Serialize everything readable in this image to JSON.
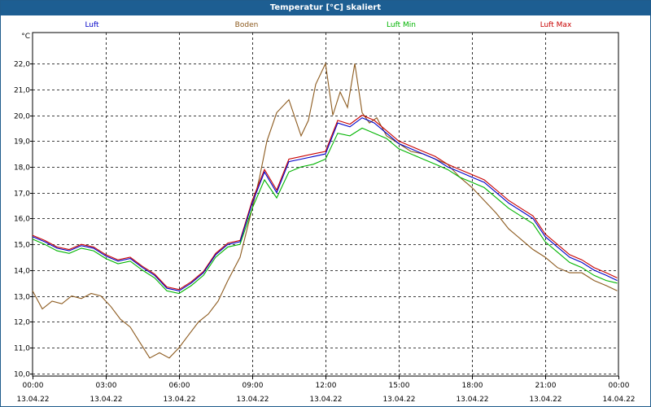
{
  "window": {
    "title": "Temperatur [°C] skaliert"
  },
  "chart_data": {
    "type": "line",
    "title": "Temperatur [°C] skaliert",
    "ylabel": "°C",
    "xlabel": "",
    "ylim": [
      9.9,
      23.2
    ],
    "xlim": [
      0,
      24
    ],
    "grid": true,
    "yticks": [
      10.0,
      11.0,
      12.0,
      13.0,
      14.0,
      15.0,
      16.0,
      17.0,
      18.0,
      19.0,
      20.0,
      21.0,
      22.0
    ],
    "ytick_labels": [
      "10,0",
      "11,0",
      "12,0",
      "13,0",
      "14,0",
      "15,0",
      "16,0",
      "17,0",
      "18,0",
      "19,0",
      "20,0",
      "21,0",
      "22,0"
    ],
    "xticks": [
      0,
      3,
      6,
      9,
      12,
      15,
      18,
      21,
      24
    ],
    "xtick_labels": [
      [
        "00:00",
        "13.04.22"
      ],
      [
        "03:00",
        "13.04.22"
      ],
      [
        "06:00",
        "13.04.22"
      ],
      [
        "09:00",
        "13.04.22"
      ],
      [
        "12:00",
        "13.04.22"
      ],
      [
        "15:00",
        "13.04.22"
      ],
      [
        "18:00",
        "13.04.22"
      ],
      [
        "21:00",
        "13.04.22"
      ],
      [
        "00:00",
        "14.04.22"
      ]
    ],
    "legend_position": "top",
    "series": [
      {
        "name": "Luft",
        "color": "#0000c8",
        "x": [
          0,
          0.5,
          1,
          1.5,
          2,
          2.5,
          3,
          3.5,
          4,
          4.5,
          5,
          5.5,
          6,
          6.5,
          7,
          7.5,
          8,
          8.5,
          9,
          9.5,
          10,
          10.5,
          11,
          11.5,
          12,
          12.5,
          13,
          13.5,
          14,
          14.5,
          15,
          15.5,
          16,
          16.5,
          17,
          17.5,
          18,
          18.5,
          19,
          19.5,
          20,
          20.5,
          21,
          21.5,
          22,
          22.5,
          23,
          23.5,
          23.95
        ],
        "y": [
          15.3,
          15.1,
          14.85,
          14.75,
          14.95,
          14.85,
          14.55,
          14.35,
          14.45,
          14.1,
          13.8,
          13.3,
          13.2,
          13.5,
          13.9,
          14.6,
          15.0,
          15.1,
          16.6,
          17.8,
          17.0,
          18.2,
          18.3,
          18.4,
          18.5,
          19.7,
          19.55,
          19.9,
          19.7,
          19.3,
          18.9,
          18.7,
          18.5,
          18.3,
          18.0,
          17.8,
          17.6,
          17.4,
          17.0,
          16.6,
          16.3,
          16.0,
          15.3,
          14.9,
          14.5,
          14.3,
          14.0,
          13.8,
          13.6
        ]
      },
      {
        "name": "Boden",
        "color": "#8c5a1e",
        "x": [
          0,
          0.4,
          0.8,
          1.2,
          1.6,
          2,
          2.4,
          2.8,
          3.2,
          3.6,
          4,
          4.4,
          4.8,
          5.2,
          5.6,
          6,
          6.4,
          6.8,
          7.2,
          7.6,
          8,
          8.5,
          9,
          9.3,
          9.6,
          10,
          10.5,
          11,
          11.3,
          11.6,
          12,
          12.3,
          12.6,
          12.9,
          13.2,
          13.5,
          13.8,
          14.1,
          14.5,
          15,
          15.5,
          16,
          16.5,
          17,
          17.5,
          18,
          18.5,
          19,
          19.5,
          20,
          20.5,
          21,
          21.5,
          22,
          22.5,
          23,
          23.5,
          23.95
        ],
        "y": [
          13.2,
          12.5,
          12.8,
          12.7,
          13.0,
          12.9,
          13.1,
          13.0,
          12.6,
          12.1,
          11.8,
          11.2,
          10.6,
          10.8,
          10.6,
          11.0,
          11.5,
          12.0,
          12.3,
          12.8,
          13.6,
          14.5,
          16.4,
          17.6,
          19.0,
          20.1,
          20.6,
          19.2,
          19.8,
          21.2,
          22.0,
          20.0,
          20.9,
          20.3,
          22.0,
          20.1,
          19.7,
          19.9,
          19.2,
          18.9,
          18.6,
          18.5,
          18.3,
          18.1,
          17.6,
          17.2,
          16.7,
          16.2,
          15.6,
          15.2,
          14.8,
          14.5,
          14.1,
          13.9,
          13.9,
          13.6,
          13.4,
          13.2
        ]
      },
      {
        "name": "Luft Min",
        "color": "#00b400",
        "x": [
          0,
          0.5,
          1,
          1.5,
          2,
          2.5,
          3,
          3.5,
          4,
          4.5,
          5,
          5.5,
          6,
          6.5,
          7,
          7.5,
          8,
          8.5,
          9,
          9.5,
          10,
          10.5,
          11,
          11.5,
          12,
          12.5,
          13,
          13.5,
          14,
          14.5,
          15,
          15.5,
          16,
          16.5,
          17,
          17.5,
          18,
          18.5,
          19,
          19.5,
          20,
          20.5,
          21,
          21.5,
          22,
          22.5,
          23,
          23.5,
          23.95
        ],
        "y": [
          15.2,
          15.0,
          14.75,
          14.65,
          14.85,
          14.75,
          14.45,
          14.25,
          14.35,
          14.0,
          13.7,
          13.2,
          13.1,
          13.4,
          13.8,
          14.5,
          14.9,
          15.0,
          16.4,
          17.5,
          16.8,
          17.8,
          18.0,
          18.1,
          18.3,
          19.3,
          19.2,
          19.5,
          19.3,
          19.1,
          18.7,
          18.5,
          18.3,
          18.1,
          17.9,
          17.6,
          17.4,
          17.2,
          16.8,
          16.4,
          16.1,
          15.8,
          15.1,
          14.7,
          14.3,
          14.1,
          13.8,
          13.6,
          13.5
        ]
      },
      {
        "name": "Luft Max",
        "color": "#c80000",
        "x": [
          0,
          0.5,
          1,
          1.5,
          2,
          2.5,
          3,
          3.5,
          4,
          4.5,
          5,
          5.5,
          6,
          6.5,
          7,
          7.5,
          8,
          8.5,
          9,
          9.5,
          10,
          10.5,
          11,
          11.5,
          12,
          12.5,
          13,
          13.5,
          14,
          14.5,
          15,
          15.5,
          16,
          16.5,
          17,
          17.5,
          18,
          18.5,
          19,
          19.5,
          20,
          20.5,
          21,
          21.5,
          22,
          22.5,
          23,
          23.5,
          23.95
        ],
        "y": [
          15.35,
          15.15,
          14.9,
          14.8,
          15.0,
          14.9,
          14.6,
          14.4,
          14.5,
          14.15,
          13.85,
          13.35,
          13.25,
          13.55,
          13.95,
          14.65,
          15.05,
          15.15,
          16.7,
          17.9,
          17.1,
          18.3,
          18.4,
          18.5,
          18.6,
          19.8,
          19.65,
          20.0,
          19.8,
          19.4,
          19.0,
          18.8,
          18.6,
          18.4,
          18.1,
          17.9,
          17.7,
          17.5,
          17.1,
          16.7,
          16.4,
          16.1,
          15.4,
          15.0,
          14.6,
          14.4,
          14.1,
          13.9,
          13.7
        ]
      }
    ]
  }
}
